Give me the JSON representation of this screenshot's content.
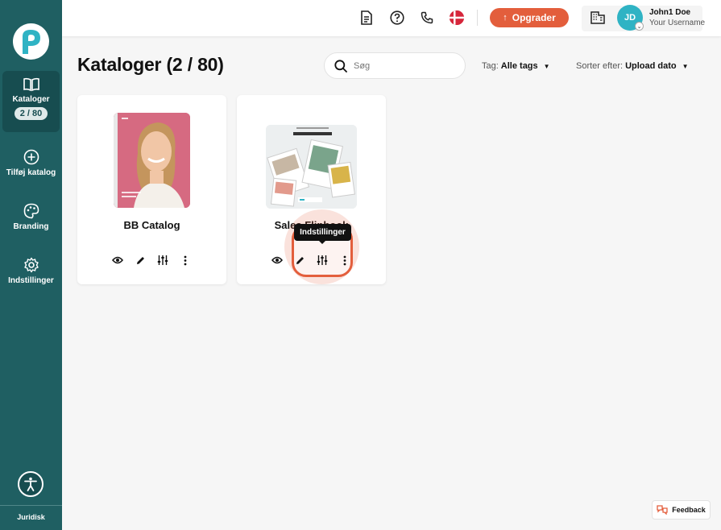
{
  "sidebar": {
    "items": [
      {
        "label": "Kataloger",
        "badge": "2 / 80",
        "icon": "book-icon"
      },
      {
        "label": "Tilføj katalog",
        "icon": "plus-circle-icon"
      },
      {
        "label": "Branding",
        "icon": "palette-icon"
      },
      {
        "label": "Indstillinger",
        "icon": "gear-icon"
      }
    ],
    "footer_link": "Juridisk"
  },
  "header": {
    "upgrade_label": "Opgrader",
    "user": {
      "initials": "JD",
      "name": "John1 Doe",
      "subtitle": "Your Username"
    }
  },
  "main": {
    "title": "Kataloger (2 / 80)",
    "search_placeholder": "Søg",
    "tag_filter": {
      "label": "Tag:",
      "value": "Alle tags"
    },
    "sort": {
      "label": "Sorter efter:",
      "value": "Upload dato"
    },
    "catalogs": [
      {
        "title": "BB Catalog"
      },
      {
        "title": "Sales Flipbook"
      }
    ],
    "tooltip": "Indstillinger"
  },
  "feedback_label": "Feedback",
  "colors": {
    "sidebar": "#1f5f62",
    "accent": "#e35e3c",
    "avatar": "#2fb3c4"
  }
}
